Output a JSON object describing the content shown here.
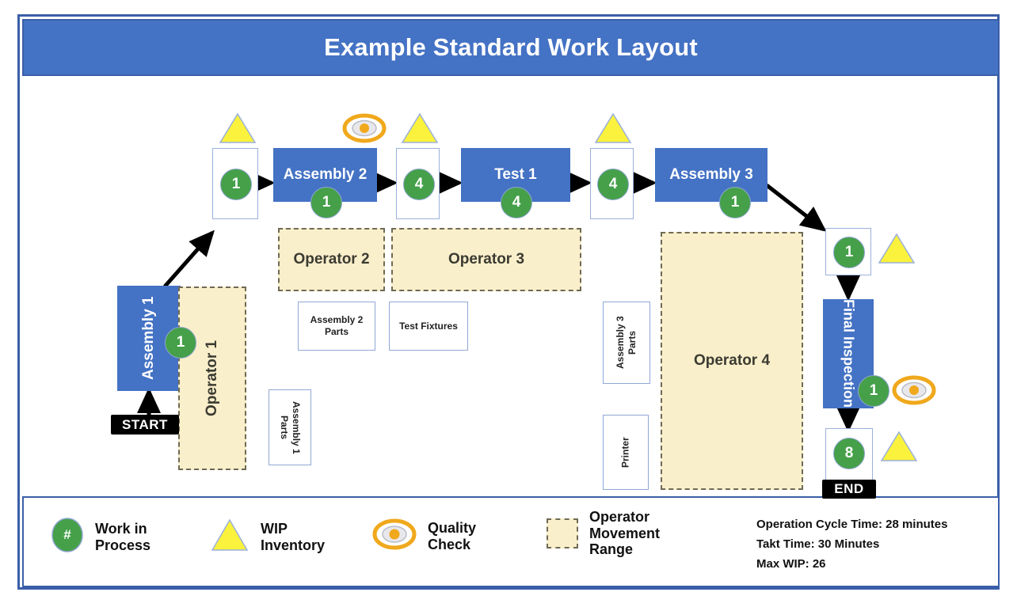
{
  "header": {
    "title": "Example Standard Work Layout"
  },
  "colors": {
    "process_blue": "#4472C4",
    "frame_blue": "#3A5FA8",
    "wip_green": "#45A049",
    "wip_triangle_yellow": "#FAF23C",
    "quality_orange": "#F0A81C",
    "operator_range_fill": "#FAEFCB",
    "operator_range_border": "#6E6A55",
    "buffer_border": "#9BB0DA",
    "tag_black": "#000000"
  },
  "flow": {
    "start_tag": "START",
    "end_tag": "END",
    "processes": [
      {
        "name": "Assembly 1",
        "wip": "1",
        "orientation": "vertical-up"
      },
      {
        "name": "Assembly 2",
        "wip": "1",
        "orientation": "horizontal"
      },
      {
        "name": "Test 1",
        "wip": "4",
        "orientation": "horizontal"
      },
      {
        "name": "Assembly 3",
        "wip": "1",
        "orientation": "horizontal"
      },
      {
        "name": "Final Inspection",
        "wip": "1",
        "orientation": "vertical-down"
      }
    ],
    "buffers": [
      {
        "id": "buffer-before-assembly-2",
        "wip": "1",
        "has_triangle": true
      },
      {
        "id": "buffer-before-test-1",
        "wip": "4",
        "has_triangle": true
      },
      {
        "id": "buffer-before-assembly-3",
        "wip": "4",
        "has_triangle": true
      },
      {
        "id": "buffer-before-final-inspection",
        "wip": "1",
        "has_triangle": true
      },
      {
        "id": "buffer-end",
        "wip": "8",
        "has_triangle": true
      }
    ],
    "quality_checks": [
      {
        "id": "quality-check-assembly-2"
      },
      {
        "id": "quality-check-final-inspection"
      }
    ]
  },
  "operator_ranges": [
    {
      "label": "Operator 1",
      "orientation": "vertical-up"
    },
    {
      "label": "Operator 2",
      "orientation": "horizontal"
    },
    {
      "label": "Operator 3",
      "orientation": "horizontal"
    },
    {
      "label": "Operator 4",
      "orientation": "horizontal"
    }
  ],
  "material_boxes": [
    {
      "label": "Assembly 1 Parts",
      "line1": "Assembly 1",
      "line2": "Parts",
      "orientation": "vertical-down"
    },
    {
      "label": "Assembly 2 Parts",
      "line1": "Assembly 2",
      "line2": "Parts",
      "orientation": "horizontal"
    },
    {
      "label": "Test Fixtures",
      "line1": "Test Fixtures",
      "line2": "",
      "orientation": "horizontal"
    },
    {
      "label": "Assembly 3 Parts",
      "line1": "Assembly 3",
      "line2": "Parts",
      "orientation": "vertical-up"
    },
    {
      "label": "Printer",
      "line1": "Printer",
      "line2": "",
      "orientation": "vertical-up"
    }
  ],
  "legend": {
    "items": [
      {
        "icon": "wip-circle-icon",
        "symbol": "#",
        "line1": "Work in",
        "line2": "Process"
      },
      {
        "icon": "wip-triangle-icon",
        "symbol": "",
        "line1": "WIP",
        "line2": "Inventory"
      },
      {
        "icon": "quality-eye-icon",
        "symbol": "",
        "line1": "Quality",
        "line2": "Check"
      },
      {
        "icon": "operator-range-swatch-icon",
        "symbol": "",
        "line1": "Operator",
        "line2": "Movement",
        "line3": "Range"
      }
    ],
    "metrics": [
      "Operation Cycle Time:  28 minutes",
      "Takt Time:  30 Minutes",
      "Max WIP:  26"
    ]
  }
}
